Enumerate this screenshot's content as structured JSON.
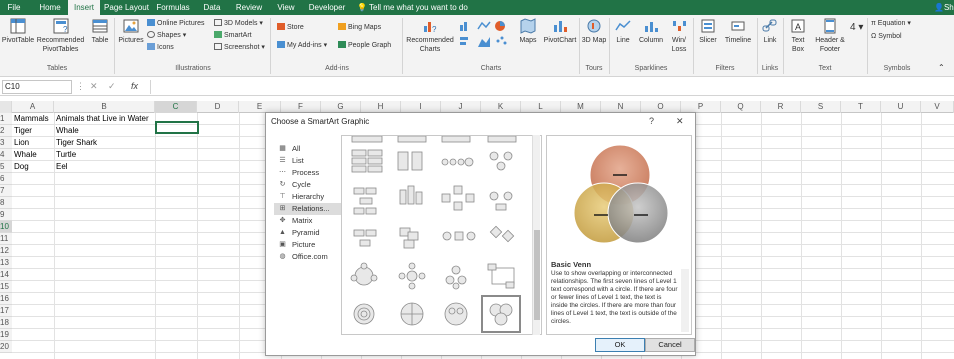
{
  "ribbon_tabs": [
    "File",
    "Home",
    "Insert",
    "Page Layout",
    "Formulas",
    "Data",
    "Review",
    "View",
    "Developer"
  ],
  "active_tab": "Insert",
  "tell_me": "Tell me what you want to do",
  "user_initials": "Sh",
  "ribbon": {
    "tables": {
      "pivottable": "PivotTable",
      "recommended": "Recommended PivotTables",
      "table": "Table",
      "group": "Tables"
    },
    "illustrations": {
      "pictures": "Pictures",
      "online_pictures": "Online Pictures",
      "shapes": "Shapes",
      "icons": "Icons",
      "models_3d": "3D Models",
      "smartart": "SmartArt",
      "screenshot": "Screenshot",
      "group": "Illustrations"
    },
    "addins": {
      "store": "Store",
      "my_addins": "My Add-ins",
      "bing_maps": "Bing Maps",
      "people_graph": "People Graph",
      "group": "Add-ins"
    },
    "charts": {
      "recommended": "Recommended Charts",
      "maps": "Maps",
      "pivotchart": "PivotChart",
      "group": "Charts"
    },
    "tours": {
      "map_3d": "3D Map",
      "group": "Tours"
    },
    "sparklines": {
      "line": "Line",
      "column": "Column",
      "winloss": "Win/ Loss",
      "group": "Sparklines"
    },
    "filters": {
      "slicer": "Slicer",
      "timeline": "Timeline",
      "group": "Filters"
    },
    "links": {
      "link": "Link",
      "group": "Links"
    },
    "text": {
      "textbox": "Text Box",
      "header_footer": "Header & Footer",
      "group": "Text"
    },
    "symbols": {
      "equation": "Equation",
      "symbol": "Symbol",
      "group": "Symbols"
    }
  },
  "name_box": "C10",
  "fx": "fx",
  "columns": [
    "A",
    "B",
    "C",
    "D",
    "E",
    "F",
    "G",
    "H",
    "I",
    "J",
    "K",
    "L",
    "M",
    "N",
    "O",
    "P",
    "Q",
    "R",
    "S",
    "T",
    "U",
    "V"
  ],
  "rows": [
    "1",
    "2",
    "3",
    "4",
    "5",
    "6",
    "7",
    "8",
    "9",
    "10",
    "11",
    "12",
    "13",
    "14",
    "15",
    "16",
    "17",
    "18",
    "19",
    "20"
  ],
  "cells": {
    "A1": "Mammals",
    "B1": "Animals that Live in Water",
    "A2": "Tiger",
    "B2": "Whale",
    "A3": "Lion",
    "B3": "Tiger Shark",
    "A4": "Whale",
    "B4": "Turtle",
    "A5": "Dog",
    "B5": "Eel"
  },
  "dialog": {
    "title": "Choose a SmartArt Graphic",
    "help": "?",
    "close": "✕",
    "categories": [
      "All",
      "List",
      "Process",
      "Cycle",
      "Hierarchy",
      "Relations...",
      "Matrix",
      "Pyramid",
      "Picture",
      "Office.com"
    ],
    "selected_category": "Relations...",
    "preview_title": "Basic Venn",
    "preview_description": "Use to show overlapping or interconnected relationships. The first seven lines of Level 1 text correspond with a circle. If there are four or fewer lines of Level 1 text, the text is inside the circles. If there are more than four lines of Level 1 text, the text is outside of the circles.",
    "ok": "OK",
    "cancel": "Cancel"
  },
  "colors": {
    "excel_green": "#217346",
    "venn_top": "#d4866a",
    "venn_left": "#d4b45a",
    "venn_right": "#9e9e9e"
  }
}
